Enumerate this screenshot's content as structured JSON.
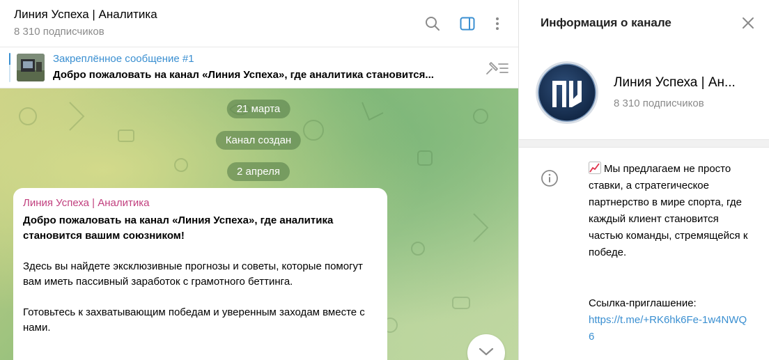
{
  "chat": {
    "title": "Линия Успеха | Аналитика",
    "subscribers": "8 310 подписчиков",
    "icons": [
      "search-icon",
      "sidebar-toggle-icon",
      "more-vertical-icon"
    ],
    "pinned": {
      "title": "Закреплённое сообщение #1",
      "text": "Добро пожаловать на канал «Линия Успеха», где аналитика становится..."
    },
    "service": {
      "date1": "21 марта",
      "created": "Канал создан",
      "date2": "2 апреля"
    },
    "message": {
      "author": "Линия Успеха | Аналитика",
      "bold": "Добро пожаловать на канал «Линия Успеха», где аналитика становится вашим союзником!",
      "p1": "Здесь вы найдете эксклюзивные прогнозы и советы, которые помогут вам иметь пассивный заработок с грамотного беттинга.",
      "p2": "Готовьтесь к захватывающим победам и уверенным заходам вместе с нами."
    }
  },
  "info": {
    "header": "Информация о канале",
    "name": "Линия Успеха | Ан...",
    "subscribers": "8 310 подписчиков",
    "avatar_letters": "ЛУ",
    "about": "Мы предлагаем не просто ставки, а стратегическое партнерство в мире спорта, где каждый клиент становится частью команды, стремящейся к победе.",
    "link_label": "Ссылка-приглашение:",
    "link": "https://t.me/+RK6hk6Fe-1w4NWQ6"
  },
  "colors": {
    "accent": "#3a8fd1",
    "author": "#c13f7e"
  }
}
